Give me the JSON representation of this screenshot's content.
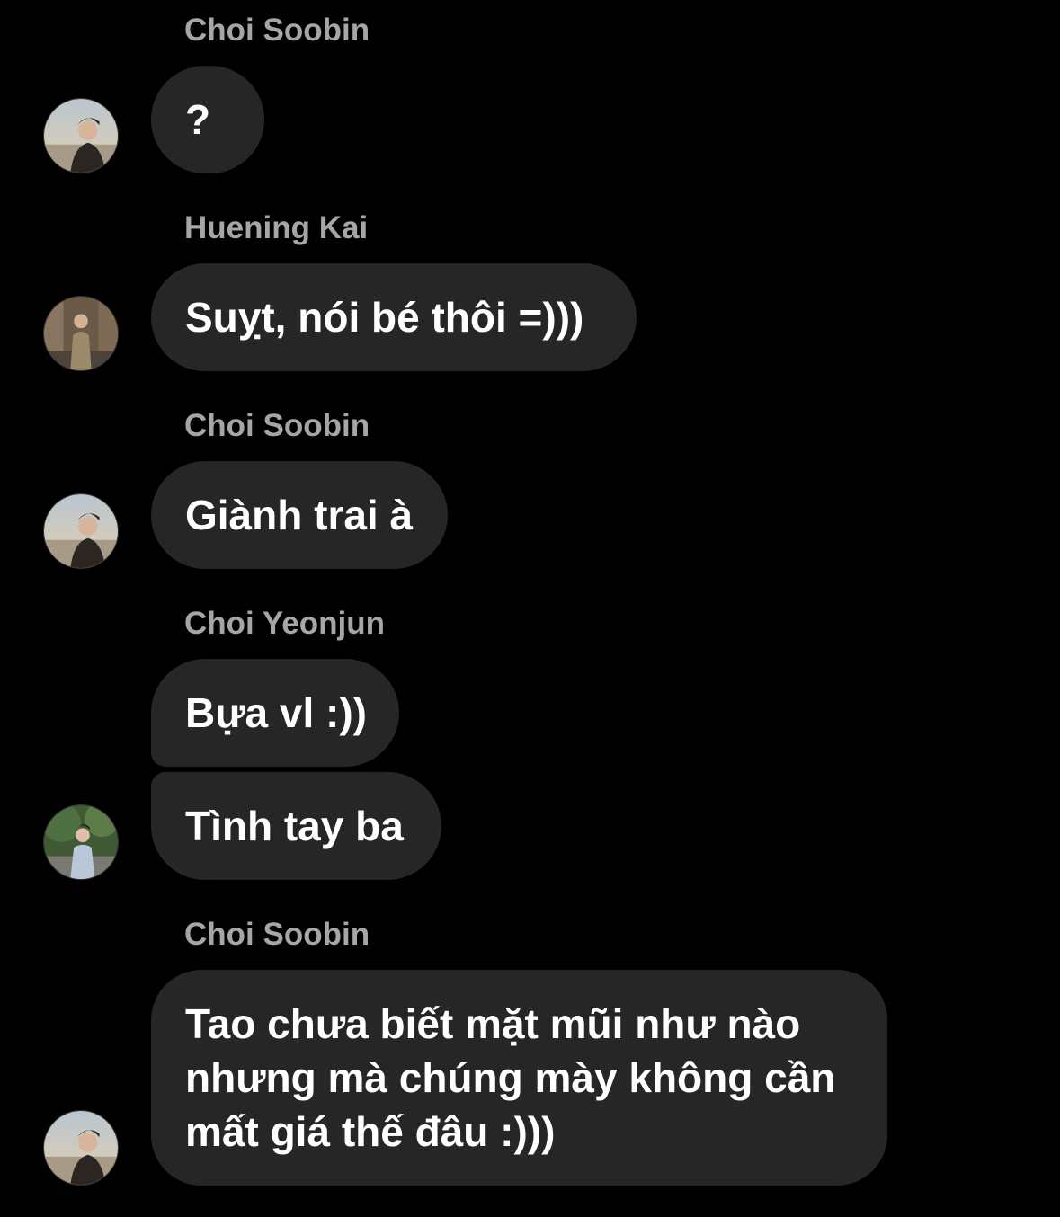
{
  "messages": [
    {
      "sender": "Choi Soobin",
      "text": "?"
    },
    {
      "sender": "Huening Kai",
      "text": "Suỵt, nói bé thôi =)))"
    },
    {
      "sender": "Choi Soobin",
      "text": "Giành trai à"
    },
    {
      "sender": "Choi Yeonjun",
      "text_1": "Bựa vl :))",
      "text_2": "Tình tay ba"
    },
    {
      "sender": "Choi Soobin",
      "text": "Tao chưa biết mặt mũi như nào nhưng mà chúng mày không cần mất giá thế đâu :)))"
    }
  ],
  "colors": {
    "background": "#000000",
    "bubble": "#262626",
    "sender_name": "#a6a6a6",
    "message_text": "#ffffff"
  },
  "icons": {
    "soobin_avatar": "avatar-soobin-beach-photo",
    "kai_avatar": "avatar-kai-street-photo",
    "yeonjun_avatar": "avatar-yeonjun-park-photo"
  }
}
